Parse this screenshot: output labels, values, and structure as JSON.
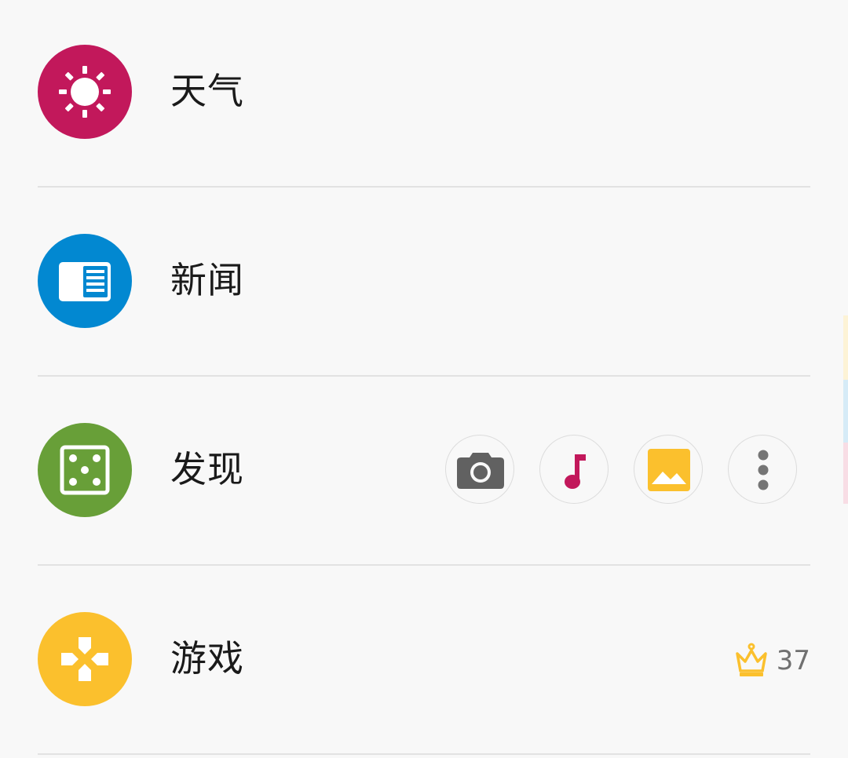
{
  "items": [
    {
      "label": "天气",
      "icon": "sun-icon",
      "color": "#c2185b"
    },
    {
      "label": "新闻",
      "icon": "newspaper-icon",
      "color": "#0288d1"
    },
    {
      "label": "发现",
      "icon": "dice-icon",
      "color": "#689f38"
    },
    {
      "label": "游戏",
      "icon": "gamepad-icon",
      "color": "#fbc02d"
    }
  ],
  "discover_shortcuts": [
    {
      "icon": "camera-icon",
      "color": "#616161"
    },
    {
      "icon": "music-note-icon",
      "color": "#c2185b"
    },
    {
      "icon": "gallery-icon",
      "color": "#fbc02d"
    },
    {
      "icon": "more-vertical-icon",
      "color": "#757575"
    }
  ],
  "game_badge": {
    "icon": "crown-icon",
    "count": "37",
    "color": "#fbc02d"
  },
  "edge_panel_colors": [
    "#fdf3d6",
    "#d6ebf7",
    "#f8dde5"
  ]
}
